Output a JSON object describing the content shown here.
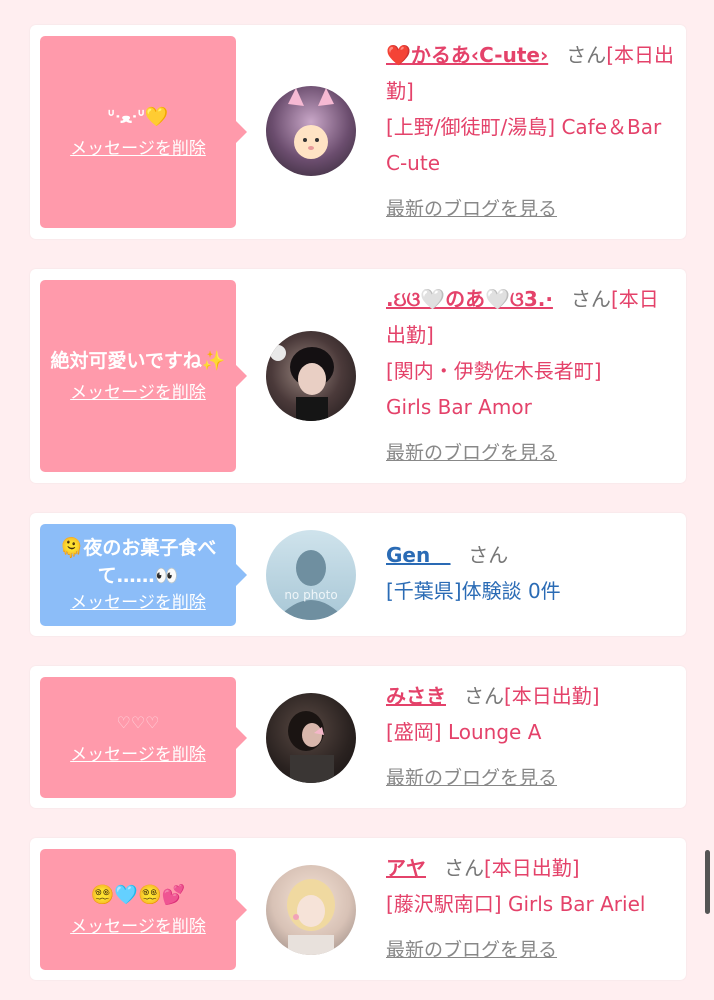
{
  "cards": [
    {
      "message": "ᐡᐧﻌᐧᐡ💛",
      "delete_label": "メッセージを削除",
      "name": "❤️かるあ‹C-ute›",
      "san": "さん",
      "status": "[本日出勤]",
      "shop": "[上野/御徒町/湯島] Cafe＆Bar C-ute",
      "blog_label": "最新のブログを見る"
    },
    {
      "message": "絶対可愛いですね✨",
      "delete_label": "メッセージを削除",
      "name": ".ઇଓ🤍のあ🤍ଓ3.·",
      "san": "さん",
      "status": "[本日出勤]",
      "shop": "[関内・伊勢佐木長者町] Girls Bar Amor",
      "blog_label": "最新のブログを見る"
    },
    {
      "message": "🫠夜のお菓子食べて……👀",
      "delete_label": "メッセージを削除",
      "name": "Gen＿",
      "san": "さん",
      "shop": "[千葉県]体験談 0件",
      "avatar_text": "no photo"
    },
    {
      "message": "♡♡♡",
      "delete_label": "メッセージを削除",
      "name": "みさき",
      "san": "さん",
      "status": "[本日出勤]",
      "shop": "[盛岡] Lounge A",
      "blog_label": "最新のブログを見る"
    },
    {
      "message": "😵‍💫🩵😵‍💫💕",
      "delete_label": "メッセージを削除",
      "name": "アヤ",
      "san": "さん",
      "status": "[本日出勤]",
      "shop": "[藤沢駅南口] Girls Bar Ariel",
      "blog_label": "最新のブログを見る"
    }
  ]
}
